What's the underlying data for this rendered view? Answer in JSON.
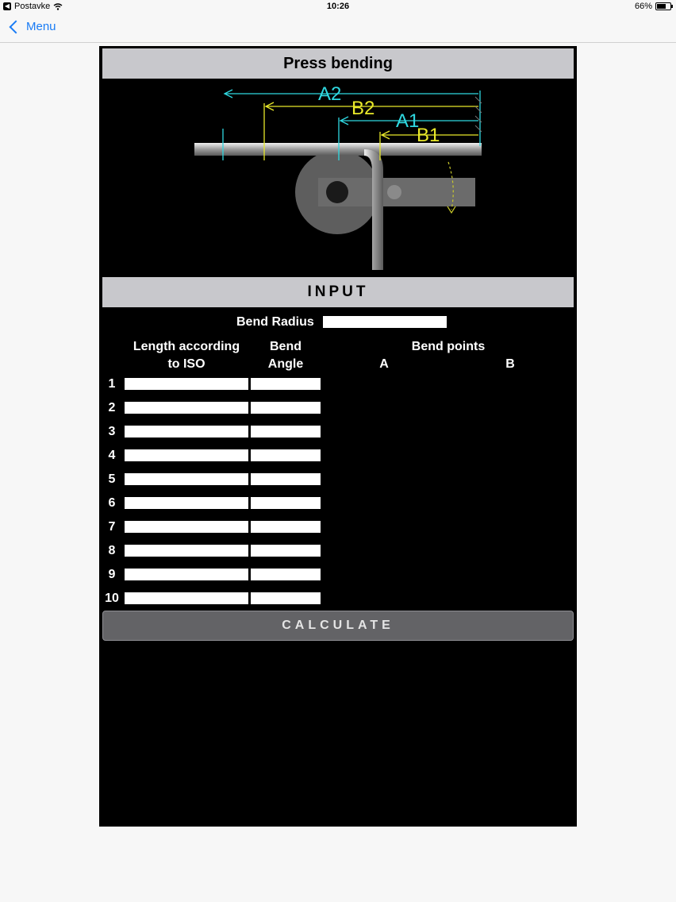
{
  "status": {
    "carrier": "Postavke",
    "time": "10:26",
    "battery": "66%",
    "battery_level": 0.66
  },
  "nav": {
    "back_label": "Menu"
  },
  "title": "Press bending",
  "diagram": {
    "labels": [
      "A2",
      "B2",
      "A1",
      "B1"
    ]
  },
  "section": "INPUT",
  "bend_radius": {
    "label": "Bend Radius",
    "value": ""
  },
  "columns": {
    "length_line1": "Length according",
    "length_line2": "to ISO",
    "angle_line1": "Bend",
    "angle_line2": "Angle",
    "points": "Bend points",
    "a": "A",
    "b": "B"
  },
  "rows": [
    {
      "num": "1",
      "length": "",
      "angle": ""
    },
    {
      "num": "2",
      "length": "",
      "angle": ""
    },
    {
      "num": "3",
      "length": "",
      "angle": ""
    },
    {
      "num": "4",
      "length": "",
      "angle": ""
    },
    {
      "num": "5",
      "length": "",
      "angle": ""
    },
    {
      "num": "6",
      "length": "",
      "angle": ""
    },
    {
      "num": "7",
      "length": "",
      "angle": ""
    },
    {
      "num": "8",
      "length": "",
      "angle": ""
    },
    {
      "num": "9",
      "length": "",
      "angle": ""
    },
    {
      "num": "10",
      "length": "",
      "angle": ""
    }
  ],
  "calculate_label": "CALCULATE",
  "colors": {
    "accent": "#1a7cf5",
    "bar": "#c8c8cc",
    "panel": "#000000",
    "button": "#636366",
    "cyan": "#2fd8e0",
    "yellow": "#e8e82a"
  }
}
